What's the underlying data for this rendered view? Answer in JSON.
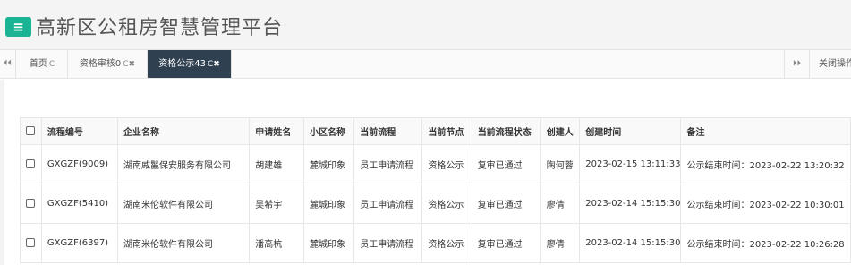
{
  "app": {
    "menu_icon": "≡",
    "title": "高新区公租房智慧管理平台"
  },
  "tabs": {
    "scroll_left": "⏴⏴",
    "scroll_right": "⏵⏵",
    "close_ops": "关闭操作",
    "items": [
      {
        "label": "首页",
        "icons": "C"
      },
      {
        "label": "资格审核0",
        "icons": "C✖"
      },
      {
        "label": "资格公示43",
        "icons": "C✖"
      }
    ]
  },
  "table": {
    "headers": [
      "流程编号",
      "企业名称",
      "申请姓名",
      "小区名称",
      "当前流程",
      "当前节点",
      "当前流程状态",
      "创建人",
      "创建时间",
      "备注"
    ],
    "rows": [
      [
        "GXGZF(9009)",
        "湖南威鬣保安服务有限公司",
        "胡建雄",
        "麓城印象",
        "员工申请流程",
        "资格公示",
        "复审已通过",
        "陶何蓉",
        "2023-02-15 13:11:33",
        "公示结束时间：2023-02-22 13:20:32"
      ],
      [
        "GXGZF(5410)",
        "湖南米伦软件有限公司",
        "吴希宇",
        "麓城印象",
        "员工申请流程",
        "资格公示",
        "复审已通过",
        "廖倩",
        "2023-02-14 15:15:30",
        "公示结束时间：2023-02-22 10:30:01"
      ],
      [
        "GXGZF(6397)",
        "湖南米伦软件有限公司",
        "潘高杭",
        "麓城印象",
        "员工申请流程",
        "资格公示",
        "复审已通过",
        "廖倩",
        "2023-02-14 15:15:30",
        "公示结束时间：2023-02-22 10:26:28"
      ]
    ]
  }
}
